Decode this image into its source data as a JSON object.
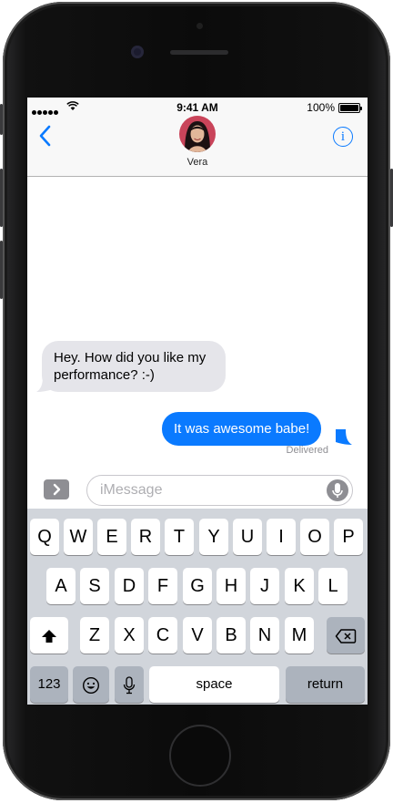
{
  "status_bar": {
    "time": "9:41 AM",
    "battery": "100%"
  },
  "header": {
    "contact_name": "Vera"
  },
  "messages": [
    {
      "direction": "incoming",
      "text": "Hey. How did you like my performance? :-)"
    },
    {
      "direction": "outgoing",
      "text": "It was awesome babe!"
    }
  ],
  "delivery_status": "Delivered",
  "composer": {
    "placeholder": "iMessage"
  },
  "keyboard": {
    "row1": [
      "Q",
      "W",
      "E",
      "R",
      "T",
      "Y",
      "U",
      "I",
      "O",
      "P"
    ],
    "row2": [
      "A",
      "S",
      "D",
      "F",
      "G",
      "H",
      "J",
      "K",
      "L"
    ],
    "row3": [
      "Z",
      "X",
      "C",
      "V",
      "B",
      "N",
      "M"
    ],
    "numbers_label": "123",
    "space_label": "space",
    "return_label": "return"
  },
  "icons": [
    "back-chevron-icon",
    "info-icon",
    "wifi-icon",
    "apps-icon",
    "microphone-icon",
    "shift-icon",
    "delete-icon",
    "emoji-icon",
    "dictation-icon"
  ],
  "colors": {
    "accent": "#0a7aff",
    "incoming_bubble": "#e5e5ea",
    "keyboard_bg": "#d1d5db"
  }
}
